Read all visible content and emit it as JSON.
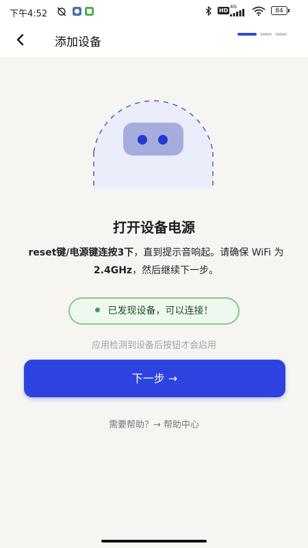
{
  "status_bar": {
    "time": "下午4:52",
    "hd": "HD",
    "network": "4G",
    "battery": "84"
  },
  "header": {
    "title": "添加设备",
    "steps_total": 3,
    "step_current": 1
  },
  "main": {
    "heading": "打开设备电源",
    "desc_reset": "reset键/电源键连按3下",
    "desc_mid": "，直到提示音响起。请确保 WiFi 为 ",
    "desc_freq": "2.4GHz",
    "desc_end": "，然后继续下一步。",
    "found_text": "已发现设备，可以连接！",
    "hint": "应用检测到设备后按钮才会启用",
    "next_button": "下一步 →",
    "help": "需要帮助？→ 帮助中心"
  },
  "colors": {
    "accent": "#2d43e0",
    "success": "#3aa548",
    "background": "#f6f5f2"
  }
}
